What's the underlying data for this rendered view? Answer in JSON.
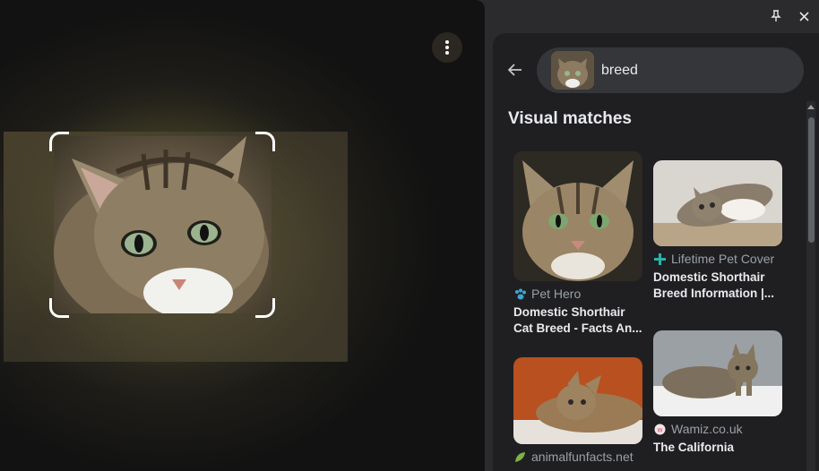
{
  "window": {
    "pin_icon": "pin-icon",
    "close_icon": "close-icon"
  },
  "viewer": {
    "more_icon": "more-vert-icon"
  },
  "panel": {
    "search": {
      "query": "breed"
    },
    "section_title": "Visual matches",
    "results": [
      {
        "source": "Pet Hero",
        "title_line1": "Domestic Shorthair",
        "title_line2": "Cat Breed - Facts An...",
        "fav_color": "#3ba7d4"
      },
      {
        "source": "Lifetime Pet Cover",
        "title_line1": "Domestic Shorthair",
        "title_line2": "Breed Information |...",
        "fav_color": "#2ab3a8"
      },
      {
        "source": "Wamiz.co.uk",
        "title_line1": "The California",
        "title_line2": "",
        "fav_color": "#d04a5a"
      },
      {
        "source": "animalfunfacts.net",
        "title_line1": "",
        "title_line2": "",
        "fav_color": "#7cb342"
      }
    ]
  }
}
